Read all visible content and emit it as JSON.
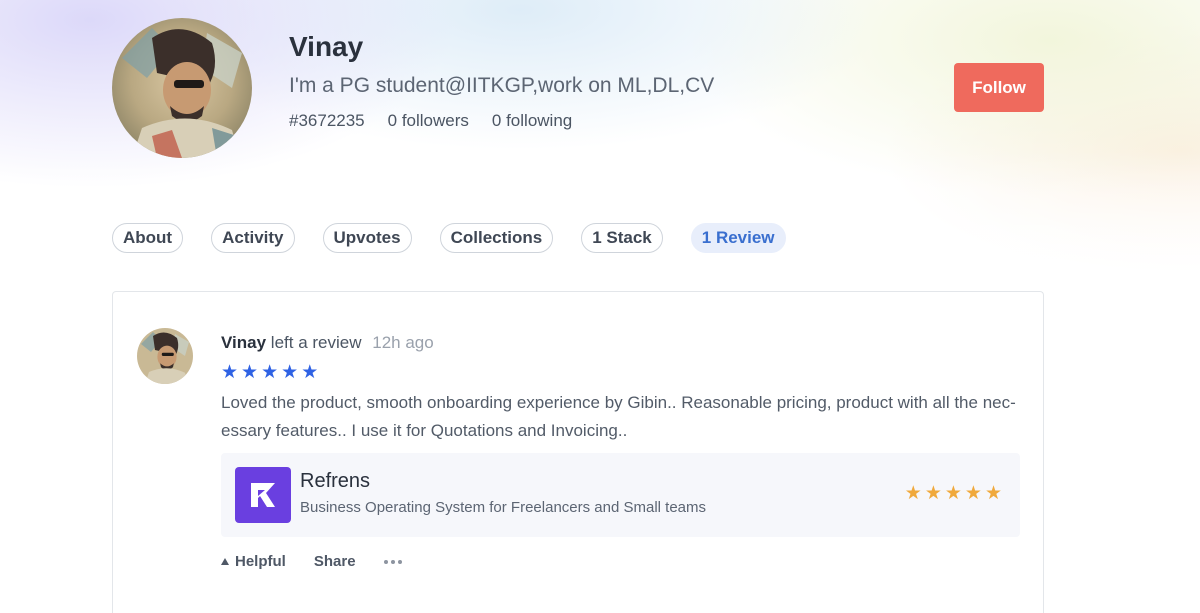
{
  "profile": {
    "name": "Vinay",
    "bio": "I'm a PG student@IITKGP,work on ML,DL,CV",
    "id": "#3672235",
    "followers": "0 followers",
    "following": "0 following",
    "follow_label": "Follow"
  },
  "tabs": [
    {
      "label": "About",
      "active": false
    },
    {
      "label": "Activity",
      "active": false
    },
    {
      "label": "Upvotes",
      "active": false
    },
    {
      "label": "Collections",
      "active": false
    },
    {
      "label": "1 Stack",
      "active": false
    },
    {
      "label": "1 Review",
      "active": true
    }
  ],
  "review": {
    "author": "Vinay",
    "action": "left a review",
    "time": "12h ago",
    "rating": 5,
    "rating_max": 5,
    "star_icon": "star-icon",
    "star_color": "#2f62e4",
    "text": "Loved the product, smooth onboarding experience by Gibin.. Reasonable pricing, product with all the nec-essary features.. I use it for Quotations and Invoicing..",
    "product": {
      "name": "Refrens",
      "tagline": "Business Operating System for Freelancers and Small teams",
      "rating": 5,
      "rating_max": 5,
      "star_color": "#f0a93c",
      "logo_color": "#6a3fe0"
    },
    "actions": {
      "helpful_label": "Helpful",
      "share_label": "Share",
      "more_icon": "more-dots-icon"
    }
  },
  "colors": {
    "accent": "#ef6a5d",
    "active_tab": "#3a6fcf"
  }
}
